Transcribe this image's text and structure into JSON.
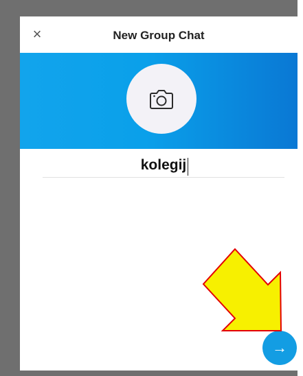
{
  "dialog": {
    "title": "New Group Chat",
    "close_icon": "close-icon",
    "close_glyph": "×",
    "group_name_value": "kolegij",
    "next_icon": "arrow-right-icon",
    "next_glyph": "→"
  },
  "annotation": {
    "arrow_color": "#f7f000",
    "arrow_outline_color": "#e30000",
    "pointing_to": "next-button"
  },
  "colors": {
    "banner_start": "#12a4ec",
    "banner_end": "#0a78d4",
    "next_button": "#139de3",
    "avatar_bg": "#f3f2f7"
  }
}
